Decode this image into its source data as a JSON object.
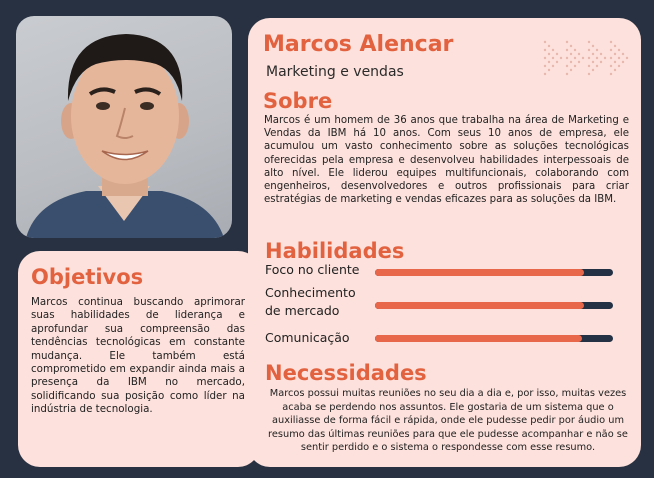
{
  "profile": {
    "name": "Marcos Alencar",
    "role": "Marketing e vendas"
  },
  "about": {
    "title": "Sobre",
    "text": "Marcos é um homem de 36 anos que trabalha na área de Marketing e Vendas da IBM há 10 anos. Com seus 10 anos de empresa, ele acumulou um vasto conhecimento sobre as soluções tecnológicas oferecidas pela empresa e desenvolveu habilidades interpessoais de alto nível.  Ele liderou equipes multifuncionais, colaborando com engenheiros, desenvolvedores e outros profissionais para criar estratégias de marketing e vendas eficazes para as soluções da IBM."
  },
  "skills": {
    "title": "Habilidades",
    "items": [
      {
        "label": "Foco no cliente",
        "level": 0.88
      },
      {
        "label": "Conhecimento de mercado",
        "level": 0.88
      },
      {
        "label": "Comunicação",
        "level": 0.87
      }
    ],
    "colors": {
      "fill": "#e8674a",
      "track": "#243043"
    }
  },
  "goals": {
    "title": "Objetivos",
    "text": "Marcos continua buscando aprimorar suas habilidades de liderança e aprofundar sua compreensão das tendências tecnológicas em constante mudança. Ele também está comprometido em expandir ainda mais a presença da IBM no mercado, solidificando sua posição como líder na indústria de tecnologia."
  },
  "needs": {
    "title": "Necessidades",
    "text": "Marcos possui muitas reuniões no seu dia a dia e, por isso, muitas vezes acaba se perdendo nos assuntos. Ele gostaria de um sistema que o auxiliasse de forma fácil e rápida, onde ele pudesse pedir por áudio um resumo das últimas reuniões para que ele pudesse acompanhar e não se sentir perdido e o sistema o respondesse com esse resumo."
  },
  "theme": {
    "accent": "#e2613f",
    "card": "#fde1dc",
    "background": "#283142"
  },
  "icons": [
    "avatar-photo",
    "dotted-arrows-decoration"
  ]
}
